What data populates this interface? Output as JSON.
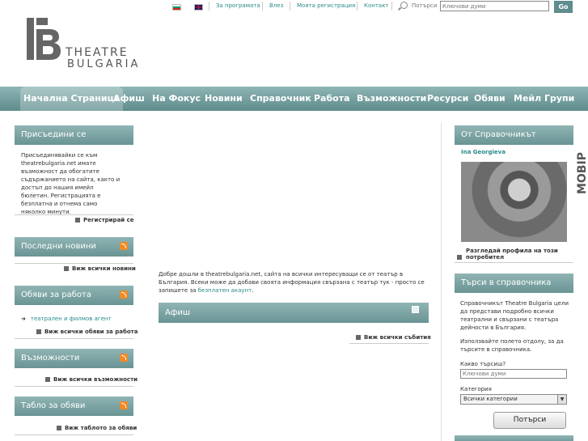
{
  "topbar": {
    "links": [
      "За програмата",
      "Влез",
      "Моята регистрация",
      "Контакт"
    ],
    "search_label": "Потърси",
    "search_placeholder": "Ключови думи",
    "go_label": "Go"
  },
  "logo": {
    "line1": "THEATRE",
    "line2": "BULGARIA"
  },
  "nav": {
    "items": [
      "Начална Страница",
      "Афиш",
      "На Фокус",
      "Новини",
      "Справочник",
      "Работа",
      "Възможности",
      "Ресурси",
      "Обяви",
      "Мейл Групи"
    ]
  },
  "left": {
    "join": {
      "title": "Присъедини се",
      "body": "Присъединявайки се към theatrebulgaria.net имате възможност да обогатите съдържанието на сайта, както и достъп до нашия имейл бюлетин. Регистрацията е безплатна и отнема само няколко минути.",
      "link": "Регистрирай се"
    },
    "news": {
      "title": "Последни новини",
      "link": "Виж всички новини"
    },
    "jobs": {
      "title": "Обяви за работа",
      "item": "театрален и филмов агент",
      "link": "Виж всички обяви за работа"
    },
    "opps": {
      "title": "Възможности",
      "link": "Виж всички възможности"
    },
    "board": {
      "title": "Табло за обяви",
      "link": "Виж таблото за обяви"
    }
  },
  "center": {
    "welcome": "Добре дошли в theatrebulgaria.net, сайта на всички интересуващи се от театър в България. Всеки може да добави своята информация свързана с театър тук - просто се запишете за ",
    "welcome_link": "безплатен акаунт",
    "welcome_end": ".",
    "afish_title": "Афиш",
    "events_link": "Виж всички събития"
  },
  "right": {
    "directory": {
      "title": "От Справочникът",
      "person": "Ina Georgieva",
      "profile_link": "Разгледай профила на този потребител"
    },
    "search": {
      "title": "Търси в справочника",
      "intro": "Справочникът Theatre Bulgaria цели да представи подробно всички театрални и свързани с театъра дейности в България.",
      "hint": "Използвайте полето отдолу, за да търсите в справочника.",
      "what_label": "Какво търсиш?",
      "what_placeholder": "Ключови думи",
      "category_label": "Категория",
      "category_value": "Всички категории",
      "button": "Потърси"
    },
    "side_word": "MOBIP"
  },
  "colors": {
    "accent": "#5f8c8c",
    "link": "#2a8a8a",
    "rss": "#f08a24"
  }
}
